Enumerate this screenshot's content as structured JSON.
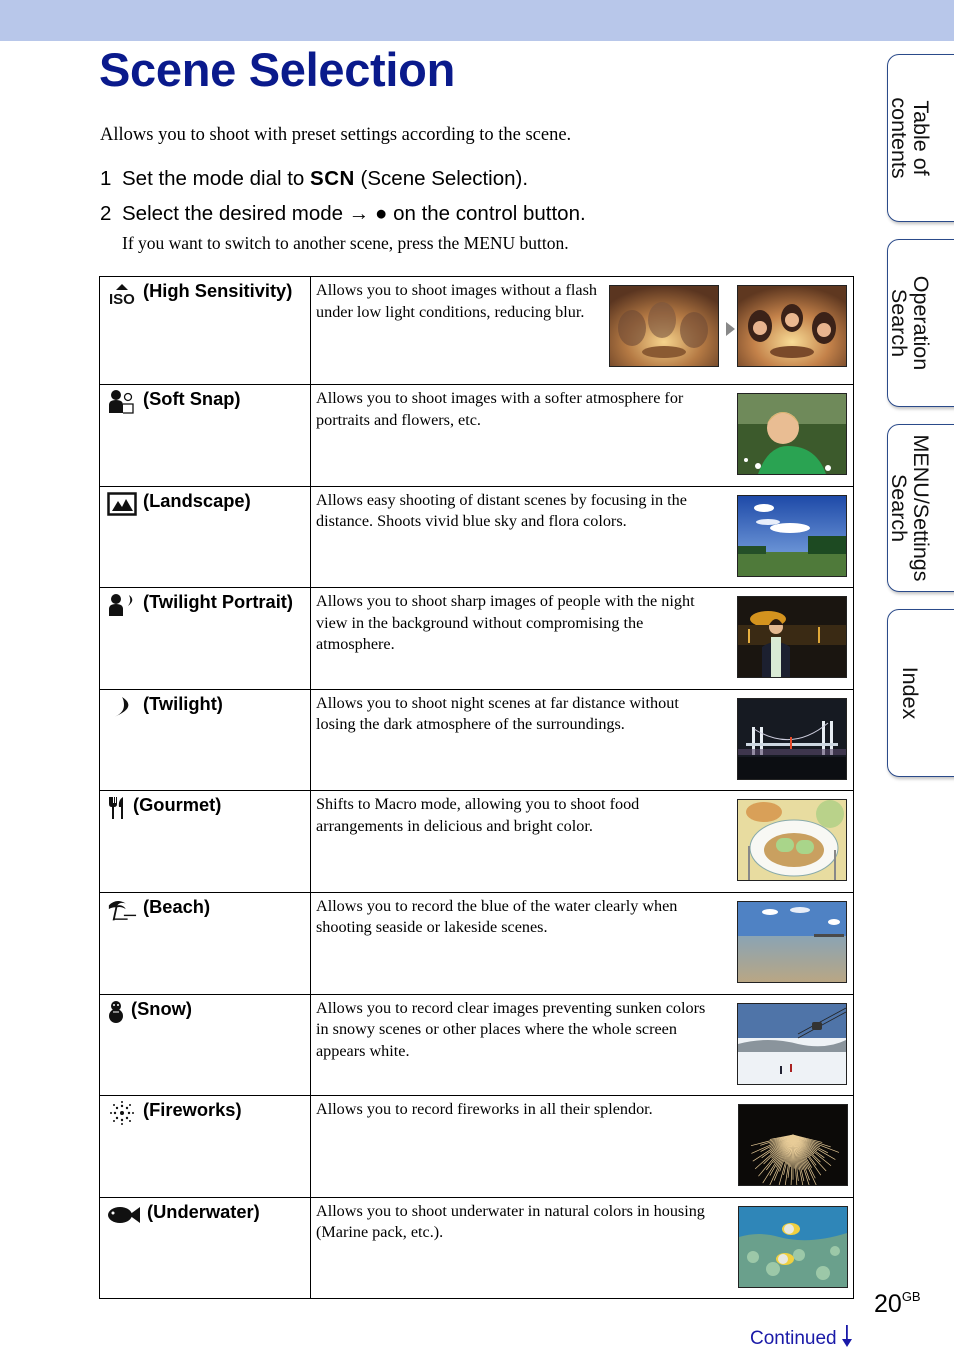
{
  "header": {
    "title": "Scene Selection",
    "band_color": "#b8c7ea",
    "title_color": "#0a1a8c"
  },
  "intro": "Allows you to shoot with preset settings according to the scene.",
  "steps": [
    {
      "num": "1",
      "before": "Set the mode dial to ",
      "icon_text": "SCN",
      "after": " (Scene Selection)."
    },
    {
      "num": "2",
      "before": "Select the desired mode ",
      "arrow": "→",
      "bullet": "●",
      "after": " on the control button."
    }
  ],
  "substep": "If you want to switch to another scene, press the MENU button.",
  "scenes": [
    {
      "icon": "high-sensitivity-icon",
      "label": "(High Sensitivity)",
      "description": "Allows you to shoot images without a flash under low light conditions, reducing blur.",
      "image": "birthday-cake-comparison"
    },
    {
      "icon": "soft-snap-icon",
      "label": "(Soft Snap)",
      "description": "Allows you to shoot images with a softer atmosphere for portraits and flowers, etc.",
      "image": "boy-portrait"
    },
    {
      "icon": "landscape-icon",
      "label": "(Landscape)",
      "description": "Allows easy shooting of distant scenes by focusing in the distance. Shoots vivid blue sky and flora colors.",
      "image": "field-sky"
    },
    {
      "icon": "twilight-portrait-icon",
      "label": "(Twilight Portrait)",
      "description": "Allows you to shoot sharp images of people with the night view in the background without compromising the atmosphere.",
      "image": "night-portrait"
    },
    {
      "icon": "twilight-icon",
      "label": "(Twilight)",
      "description": "Allows you to shoot night scenes at far distance without losing the dark atmosphere of the surroundings.",
      "image": "night-bridge"
    },
    {
      "icon": "gourmet-icon",
      "label": "(Gourmet)",
      "description": "Shifts to Macro mode, allowing you to shoot food arrangements in delicious and bright color.",
      "image": "food-plate"
    },
    {
      "icon": "beach-icon",
      "label": "(Beach)",
      "description": "Allows you to record the blue of the water clearly when shooting seaside or lakeside scenes.",
      "image": "seaside"
    },
    {
      "icon": "snow-icon",
      "label": "(Snow)",
      "description": "Allows you to record clear images preventing sunken colors in snowy scenes or other places where the whole screen appears white.",
      "image": "ski-slope"
    },
    {
      "icon": "fireworks-icon",
      "label": "(Fireworks)",
      "description": "Allows you to record fireworks in all their splendor.",
      "image": "fireworks"
    },
    {
      "icon": "underwater-icon",
      "label": "(Underwater)",
      "description": "Allows you to shoot underwater in natural colors in housing (Marine pack, etc.).",
      "image": "coral-reef"
    }
  ],
  "side_tabs": [
    {
      "label": "Table of\ncontents",
      "line1": "Table of",
      "line2": "contents"
    },
    {
      "label": "Operation\nSearch",
      "line1": "Operation",
      "line2": "Search"
    },
    {
      "label": "MENU/Settings\nSearch",
      "line1": "MENU/Settings",
      "line2": "Search"
    },
    {
      "label": "Index",
      "line1": "Index",
      "line2": ""
    }
  ],
  "footer": {
    "page_number": "20",
    "page_suffix": "GB",
    "continued": "Continued",
    "continued_color": "#1a1aa8"
  }
}
